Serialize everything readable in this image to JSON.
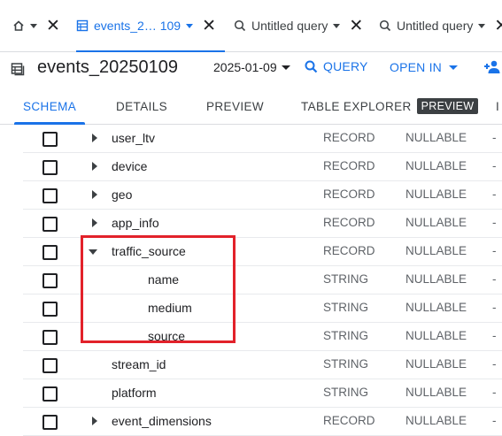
{
  "tabs": [
    {
      "id": "home",
      "icon": "home-icon",
      "label": ""
    },
    {
      "id": "events",
      "icon": "table-icon",
      "label": "events_2… 109",
      "active": true
    },
    {
      "id": "q1",
      "icon": "query-icon",
      "label": "Untitled query"
    },
    {
      "id": "q2",
      "icon": "query-icon",
      "label": "Untitled query"
    }
  ],
  "toolbar": {
    "title": "events_20250109",
    "date": "2025-01-09",
    "query_label": "QUERY",
    "open_in_label": "OPEN IN"
  },
  "view_tabs": {
    "schema": "SCHEMA",
    "details": "DETAILS",
    "preview": "PREVIEW",
    "explorer": "TABLE EXPLORER",
    "explorer_badge": "PREVIEW",
    "more": "I"
  },
  "fields": [
    {
      "name": "user_ltv",
      "type": "RECORD",
      "mode": "NULLABLE",
      "desc": "-",
      "level": 0,
      "expander": "collapsed"
    },
    {
      "name": "device",
      "type": "RECORD",
      "mode": "NULLABLE",
      "desc": "-",
      "level": 0,
      "expander": "collapsed"
    },
    {
      "name": "geo",
      "type": "RECORD",
      "mode": "NULLABLE",
      "desc": "-",
      "level": 0,
      "expander": "collapsed"
    },
    {
      "name": "app_info",
      "type": "RECORD",
      "mode": "NULLABLE",
      "desc": "-",
      "level": 0,
      "expander": "collapsed"
    },
    {
      "name": "traffic_source",
      "type": "RECORD",
      "mode": "NULLABLE",
      "desc": "-",
      "level": 0,
      "expander": "expanded"
    },
    {
      "name": "name",
      "type": "STRING",
      "mode": "NULLABLE",
      "desc": "-",
      "level": 1,
      "expander": "none"
    },
    {
      "name": "medium",
      "type": "STRING",
      "mode": "NULLABLE",
      "desc": "-",
      "level": 1,
      "expander": "none"
    },
    {
      "name": "source",
      "type": "STRING",
      "mode": "NULLABLE",
      "desc": "-",
      "level": 1,
      "expander": "none"
    },
    {
      "name": "stream_id",
      "type": "STRING",
      "mode": "NULLABLE",
      "desc": "-",
      "level": 0,
      "expander": "none"
    },
    {
      "name": "platform",
      "type": "STRING",
      "mode": "NULLABLE",
      "desc": "-",
      "level": 0,
      "expander": "none"
    },
    {
      "name": "event_dimensions",
      "type": "RECORD",
      "mode": "NULLABLE",
      "desc": "-",
      "level": 0,
      "expander": "collapsed"
    }
  ],
  "colors": {
    "accent": "#1a73e8",
    "highlight": "#e2212a"
  }
}
